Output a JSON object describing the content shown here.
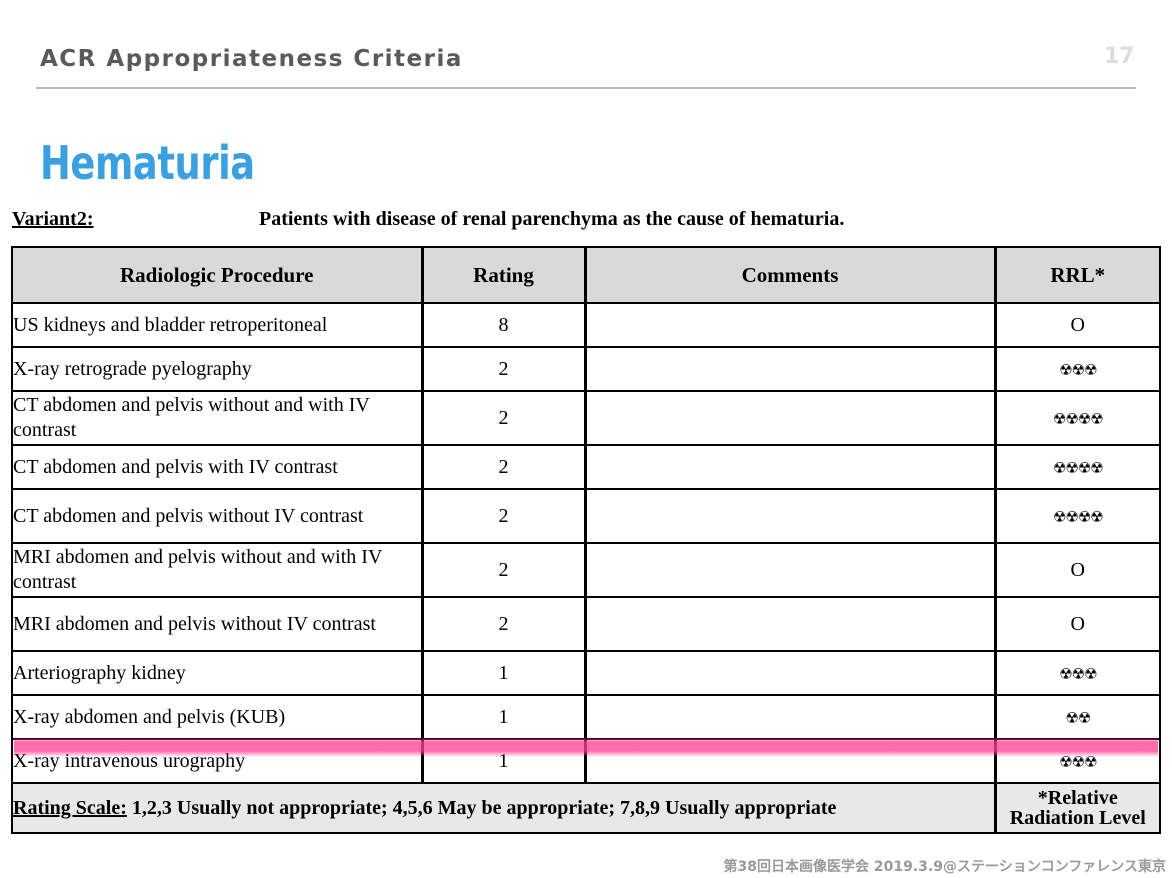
{
  "header": {
    "title": "ACR Appropriateness Criteria",
    "page_number": "17"
  },
  "slide_title": "Hematuria",
  "variant": {
    "label": "Variant2:",
    "description": "Patients with disease of renal parenchyma as the cause of hematuria."
  },
  "table": {
    "columns": [
      "Radiologic Procedure",
      "Rating",
      "Comments",
      "RRL*"
    ],
    "rows": [
      {
        "procedure": "US kidneys and bladder retroperitoneal",
        "rating": "8",
        "comments": "",
        "rrl": "O"
      },
      {
        "procedure": "X-ray retrograde pyelography",
        "rating": "2",
        "comments": "",
        "rrl": "☢☢☢"
      },
      {
        "procedure": "CT abdomen and pelvis without and with IV contrast",
        "rating": "2",
        "comments": "",
        "rrl": "☢☢☢☢"
      },
      {
        "procedure": "CT abdomen and pelvis with IV contrast",
        "rating": "2",
        "comments": "",
        "rrl": "☢☢☢☢"
      },
      {
        "procedure": "CT abdomen and pelvis without IV contrast",
        "rating": "2",
        "comments": "",
        "rrl": "☢☢☢☢"
      },
      {
        "procedure": "MRI abdomen and pelvis without and with IV contrast",
        "rating": "2",
        "comments": "",
        "rrl": "O"
      },
      {
        "procedure": "MRI abdomen and pelvis without IV contrast",
        "rating": "2",
        "comments": "",
        "rrl": "O"
      },
      {
        "procedure": "Arteriography kidney",
        "rating": "1",
        "comments": "",
        "rrl": "☢☢☢"
      },
      {
        "procedure": "X-ray abdomen and pelvis (KUB)",
        "rating": "1",
        "comments": "",
        "rrl": "☢☢"
      },
      {
        "procedure": "X-ray intravenous urography",
        "rating": "1",
        "comments": "",
        "rrl": "☢☢☢"
      }
    ],
    "footer": {
      "scale_label": "Rating Scale:",
      "scale_text": " 1,2,3 Usually not appropriate; 4,5,6 May be appropriate; 7,8,9 Usually appropriate",
      "rrl_note_line1": "*Relative",
      "rrl_note_line2": "Radiation Level"
    }
  },
  "footer_note": "第38回日本画像医学会 2019.3.9@ステーションコンファレンス東京",
  "colors": {
    "title": "#3aa0e0",
    "header_text": "#5a5a5a",
    "table_header_bg": "#d9d9d9",
    "highlight_marker": "#ff4096"
  }
}
